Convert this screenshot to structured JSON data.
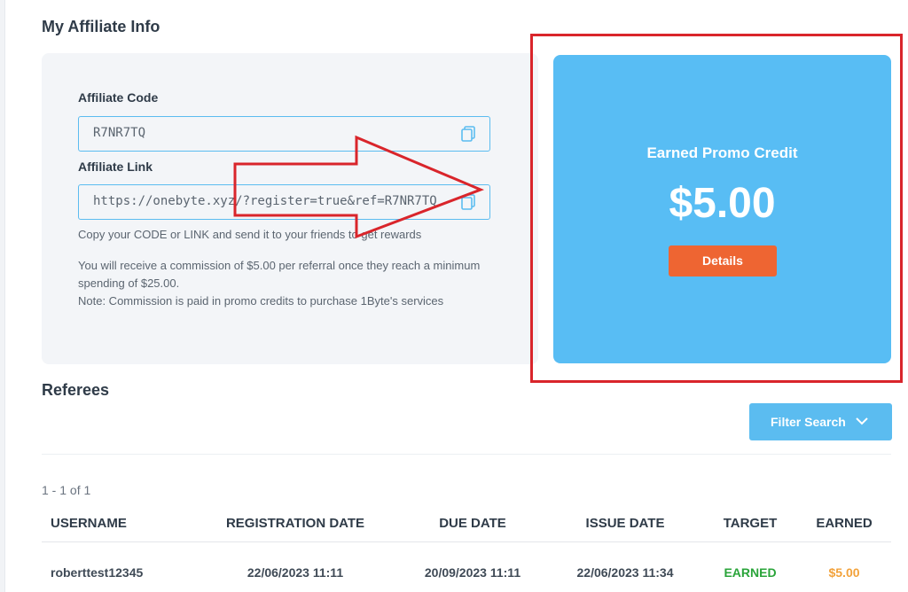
{
  "affiliate": {
    "section_title": "My Affiliate Info",
    "code_label": "Affiliate Code",
    "code_value": "R7NR7TQ",
    "link_label": "Affiliate Link",
    "link_value": "https://onebyte.xyz/?register=true&ref=R7NR7TQ",
    "copy_hint": "Copy your CODE or LINK and send it to your friends to get rewards",
    "commission_text": "You will receive a commission of $5.00 per referral once they reach a minimum spending of $25.00.",
    "note_text": "Note: Commission is paid in promo credits to purchase 1Byte's services"
  },
  "credit": {
    "title": "Earned Promo Credit",
    "amount": "$5.00",
    "details_label": "Details"
  },
  "referees": {
    "section_title": "Referees",
    "filter_label": "Filter Search",
    "pager_text": "1 - 1 of 1",
    "columns": [
      "USERNAME",
      "REGISTRATION DATE",
      "DUE DATE",
      "ISSUE DATE",
      "TARGET",
      "EARNED"
    ],
    "rows": [
      {
        "username": "roberttest12345",
        "registration_date": "22/06/2023 11:11",
        "due_date": "20/09/2023 11:11",
        "issue_date": "22/06/2023 11:34",
        "target": "EARNED",
        "earned": "$5.00"
      }
    ]
  },
  "colors": {
    "accent_blue": "#58bdf4",
    "button_orange": "#ee6532",
    "highlight_red": "#d9252b",
    "earned_green": "#2aa43a",
    "amount_orange": "#f2a23b"
  },
  "icons": {
    "copy": "copy-icon",
    "chevron": "chevron-down-icon"
  }
}
